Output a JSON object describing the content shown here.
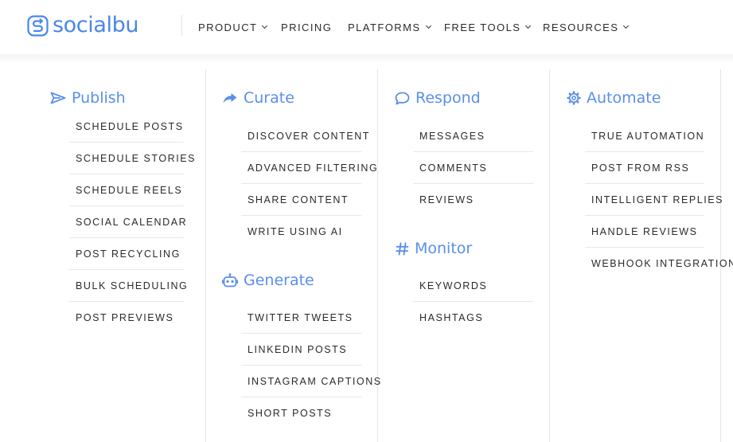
{
  "brand": {
    "name": "socialbu",
    "color": "#4a86ea"
  },
  "nav": {
    "items": [
      {
        "label": "PRODUCT",
        "has_dropdown": true
      },
      {
        "label": "PRICING",
        "has_dropdown": false
      },
      {
        "label": "PLATFORMS",
        "has_dropdown": true
      },
      {
        "label": "FREE TOOLS",
        "has_dropdown": true
      },
      {
        "label": "RESOURCES",
        "has_dropdown": true
      }
    ]
  },
  "menu": {
    "accent_color": "#5b8fe8",
    "publish": {
      "title": "Publish",
      "icon": "paper-plane-icon",
      "items": [
        "SCHEDULE POSTS",
        "SCHEDULE STORIES",
        "SCHEDULE REELS",
        "SOCIAL CALENDAR",
        "POST RECYCLING",
        "BULK SCHEDULING",
        "POST PREVIEWS"
      ]
    },
    "curate": {
      "title": "Curate",
      "icon": "share-arrow-icon",
      "items": [
        "DISCOVER CONTENT",
        "ADVANCED FILTERING",
        "SHARE CONTENT",
        "WRITE USING AI"
      ]
    },
    "generate": {
      "title": "Generate",
      "icon": "robot-icon",
      "items": [
        "TWITTER TWEETS",
        "LINKEDIN POSTS",
        "INSTAGRAM CAPTIONS",
        "SHORT POSTS"
      ]
    },
    "respond": {
      "title": "Respond",
      "icon": "chat-bubble-icon",
      "items": [
        "MESSAGES",
        "COMMENTS",
        "REVIEWS"
      ]
    },
    "monitor": {
      "title": "Monitor",
      "icon": "hashtag-icon",
      "items": [
        "KEYWORDS",
        "HASHTAGS"
      ]
    },
    "automate": {
      "title": "Automate",
      "icon": "gear-icon",
      "items": [
        "TRUE AUTOMATION",
        "POST FROM RSS",
        "INTELLIGENT REPLIES",
        "HANDLE REVIEWS",
        "WEBHOOK INTEGRATION"
      ]
    }
  }
}
